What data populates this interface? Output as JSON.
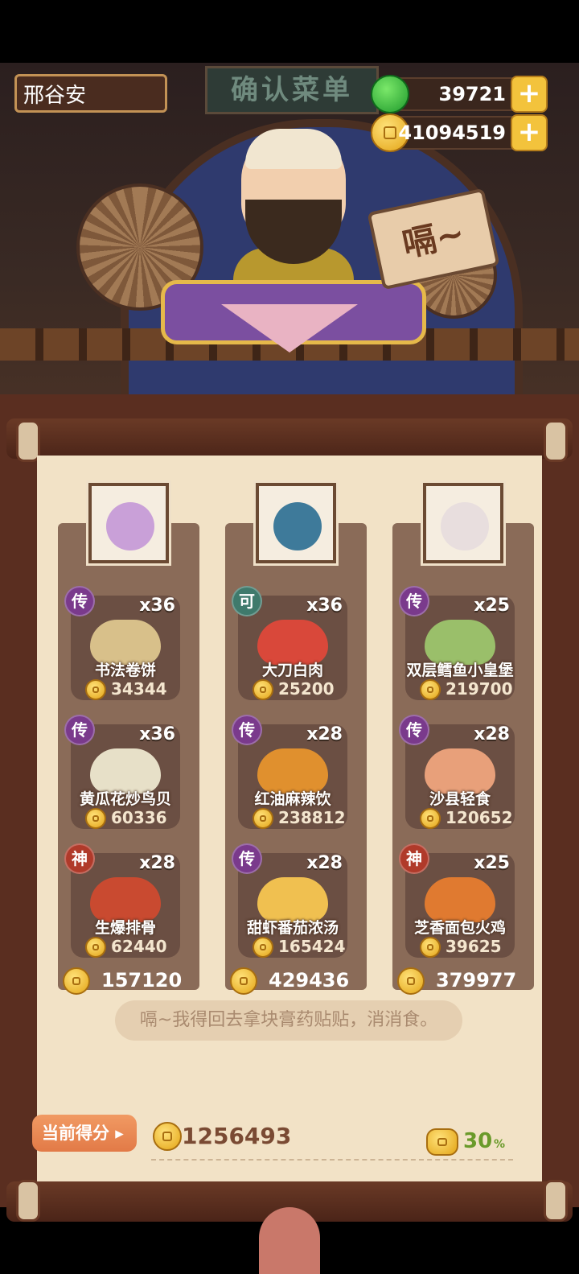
{
  "player_name": "邢谷安",
  "header_title": "确认菜单",
  "currency": {
    "gem": "39721",
    "coin": "41094519",
    "plus": "+"
  },
  "speech_sign": "嗝~",
  "columns": [
    {
      "total": "157120",
      "cards": [
        {
          "tag": "传",
          "count": "x36",
          "name": "书法卷饼",
          "price": "34344"
        },
        {
          "tag": "传",
          "count": "x36",
          "name": "黄瓜花炒鸟贝",
          "price": "60336"
        },
        {
          "tag": "神",
          "count": "x28",
          "name": "生爆排骨",
          "price": "62440"
        }
      ]
    },
    {
      "total": "429436",
      "cards": [
        {
          "tag": "可",
          "count": "x36",
          "name": "大刀白肉",
          "price": "25200"
        },
        {
          "tag": "传",
          "count": "x28",
          "name": "红油麻辣饮",
          "price": "238812"
        },
        {
          "tag": "传",
          "count": "x28",
          "name": "甜虾番茄浓汤",
          "price": "165424"
        }
      ]
    },
    {
      "total": "379977",
      "cards": [
        {
          "tag": "传",
          "count": "x25",
          "name": "双层鳕鱼小皇堡",
          "price": "219700"
        },
        {
          "tag": "传",
          "count": "x28",
          "name": "沙县轻食",
          "price": "120652"
        },
        {
          "tag": "神",
          "count": "x25",
          "name": "芝香面包火鸡",
          "price": "39625"
        }
      ]
    }
  ],
  "speech": "嗝~我得回去拿块膏药贴贴，消消食。",
  "score_label": "当前得分",
  "score_value": "1256493",
  "bonus": {
    "value": "30",
    "unit": "%"
  }
}
